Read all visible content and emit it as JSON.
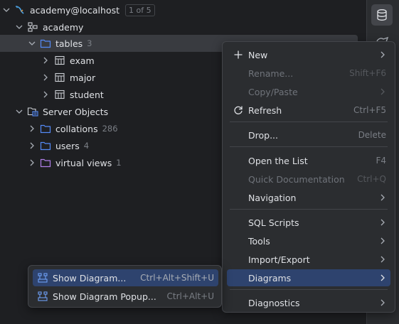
{
  "tree": {
    "connection": {
      "label": "academy@localhost",
      "badge": "1 of 5"
    },
    "schema": {
      "label": "academy"
    },
    "tables": {
      "label": "tables",
      "count": "3"
    },
    "table_items": [
      {
        "label": "exam"
      },
      {
        "label": "major"
      },
      {
        "label": "student"
      }
    ],
    "server_objects": {
      "label": "Server Objects"
    },
    "collations": {
      "label": "collations",
      "count": "286"
    },
    "users": {
      "label": "users",
      "count": "4"
    },
    "virtual_views": {
      "label": "virtual views",
      "count": "1"
    }
  },
  "context_menu": {
    "new": {
      "label": "New"
    },
    "rename": {
      "label": "Rename...",
      "shortcut": "Shift+F6"
    },
    "copy_paste": {
      "label": "Copy/Paste"
    },
    "refresh": {
      "label": "Refresh",
      "shortcut": "Ctrl+F5"
    },
    "drop": {
      "label": "Drop...",
      "shortcut": "Delete"
    },
    "open_list": {
      "label": "Open the List",
      "shortcut": "F4"
    },
    "quick_doc": {
      "label": "Quick Documentation",
      "shortcut": "Ctrl+Q"
    },
    "navigation": {
      "label": "Navigation"
    },
    "sql_scripts": {
      "label": "SQL Scripts"
    },
    "tools": {
      "label": "Tools"
    },
    "import_export": {
      "label": "Import/Export"
    },
    "diagrams": {
      "label": "Diagrams"
    },
    "diagnostics": {
      "label": "Diagnostics"
    }
  },
  "submenu": {
    "show_diagram": {
      "label": "Show Diagram...",
      "shortcut": "Ctrl+Alt+Shift+U"
    },
    "show_diagram_popup": {
      "label": "Show Diagram Popup...",
      "shortcut": "Ctrl+Alt+U"
    }
  },
  "colors": {
    "background": "#1e1f22",
    "menu_bg": "#2b2d30",
    "highlight": "#2e436e",
    "folder_blue": "#548af7",
    "folder_purple": "#b07ee8"
  }
}
